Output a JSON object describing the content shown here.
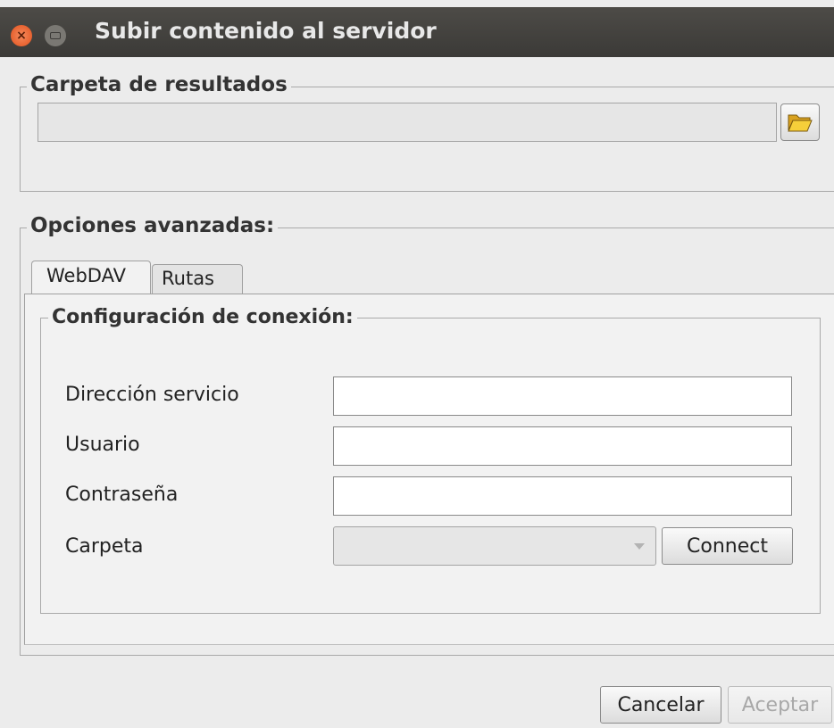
{
  "window": {
    "title": "Subir contenido al servidor"
  },
  "results_group": {
    "legend": "Carpeta de resultados",
    "folder_path_value": "",
    "browse_icon": "folder-open-icon"
  },
  "advanced_group": {
    "legend": "Opciones avanzadas:",
    "tabs": [
      {
        "label": "WebDAV",
        "selected": true
      },
      {
        "label": "Rutas",
        "selected": false
      }
    ],
    "connection_group": {
      "legend": "Configuración de conexión:",
      "fields": {
        "service_address_label": "Dirección servicio",
        "service_address_value": "",
        "user_label": "Usuario",
        "user_value": "",
        "password_label": "Contraseña",
        "password_value": "",
        "folder_label": "Carpeta",
        "folder_value": ""
      },
      "connect_label": "Connect"
    }
  },
  "footer": {
    "cancel_label": "Cancelar",
    "accept_label": "Aceptar"
  },
  "colors": {
    "titlebar": "#3b3a37",
    "close_button": "#e2511d",
    "dialog_background": "#ececec"
  }
}
